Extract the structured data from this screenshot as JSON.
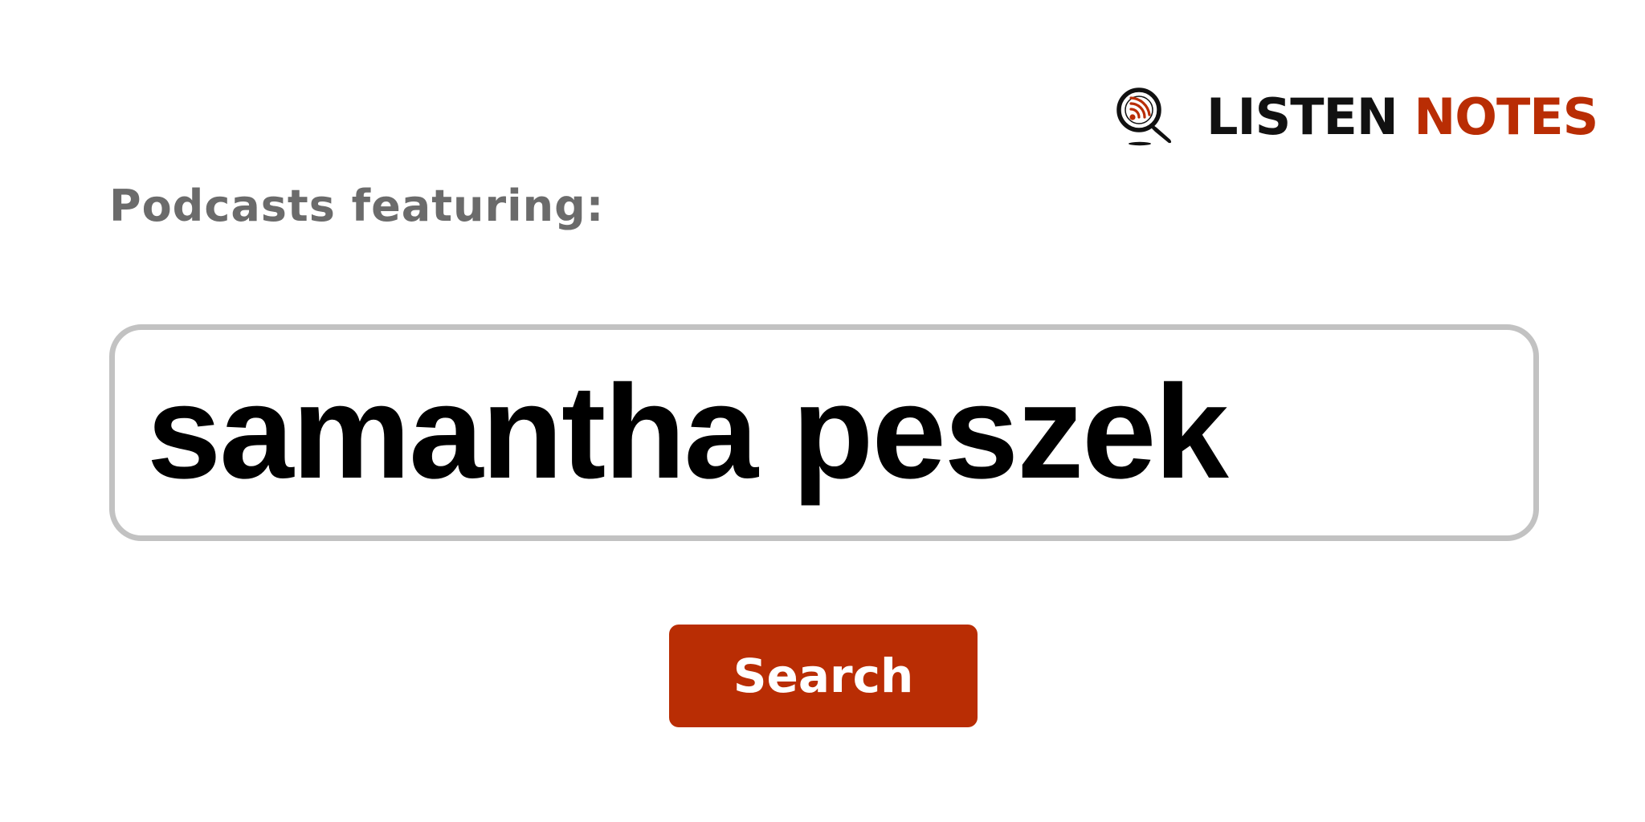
{
  "colors": {
    "accent": "#b92d04",
    "logo_dark": "#111111",
    "heading_gray": "#6b6b6b",
    "border_gray": "#c2c2c2"
  },
  "logo": {
    "icon": "magnifier-podcast-icon",
    "word_1": "LISTEN",
    "word_2": "NOTES"
  },
  "heading": "Podcasts featuring:",
  "search": {
    "value": "samantha peszek"
  },
  "button": {
    "label": "Search"
  }
}
